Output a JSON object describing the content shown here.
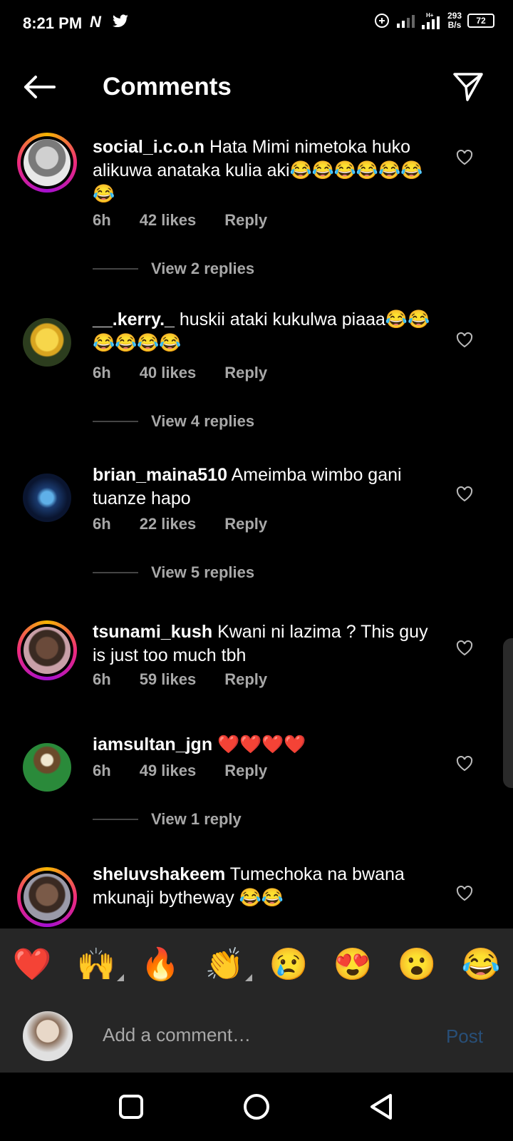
{
  "status_bar": {
    "time": "8:21 PM",
    "net_speed_value": "293",
    "net_speed_unit": "B/s",
    "battery": "72"
  },
  "header": {
    "title": "Comments"
  },
  "comments": [
    {
      "user": "social_i.c.o.n",
      "text": "Hata Mimi nimetoka huko alikuwa anataka kulia aki😂😂😂😂😂😂😂",
      "time": "6h",
      "likes": "42 likes",
      "reply": "Reply",
      "view_replies": "View 2 replies"
    },
    {
      "user": "__.kerry._",
      "text": "huskii ataki kukulwa piaaa😂😂😂😂😂😂",
      "time": "6h",
      "likes": "40 likes",
      "reply": "Reply",
      "view_replies": "View 4 replies"
    },
    {
      "user": "brian_maina510",
      "text": "Ameimba wimbo gani tuanze hapo",
      "time": "6h",
      "likes": "22 likes",
      "reply": "Reply",
      "view_replies": "View 5 replies"
    },
    {
      "user": "tsunami_kush",
      "text": "Kwani ni lazima ? This guy is just too much tbh",
      "time": "6h",
      "likes": "59 likes",
      "reply": "Reply"
    },
    {
      "user": "iamsultan_jgn",
      "text": "❤️❤️❤️❤️",
      "time": "6h",
      "likes": "49 likes",
      "reply": "Reply",
      "view_replies": "View 1 reply"
    },
    {
      "user": "sheluvshakeem",
      "text": "Tumechoka na bwana mkunaji bytheway 😂😂"
    }
  ],
  "reactions": [
    "❤️",
    "🙌",
    "🔥",
    "👏",
    "😢",
    "😍",
    "😮",
    "😂"
  ],
  "composer": {
    "placeholder": "Add a comment…",
    "post_label": "Post"
  },
  "colors": {
    "background": "#000000",
    "panel": "#262626",
    "muted_text": "#a8a8a8",
    "post_disabled": "#284f78"
  },
  "icons": {
    "back": "arrow-left-icon",
    "share": "paper-plane-icon",
    "like": "heart-outline-icon"
  }
}
